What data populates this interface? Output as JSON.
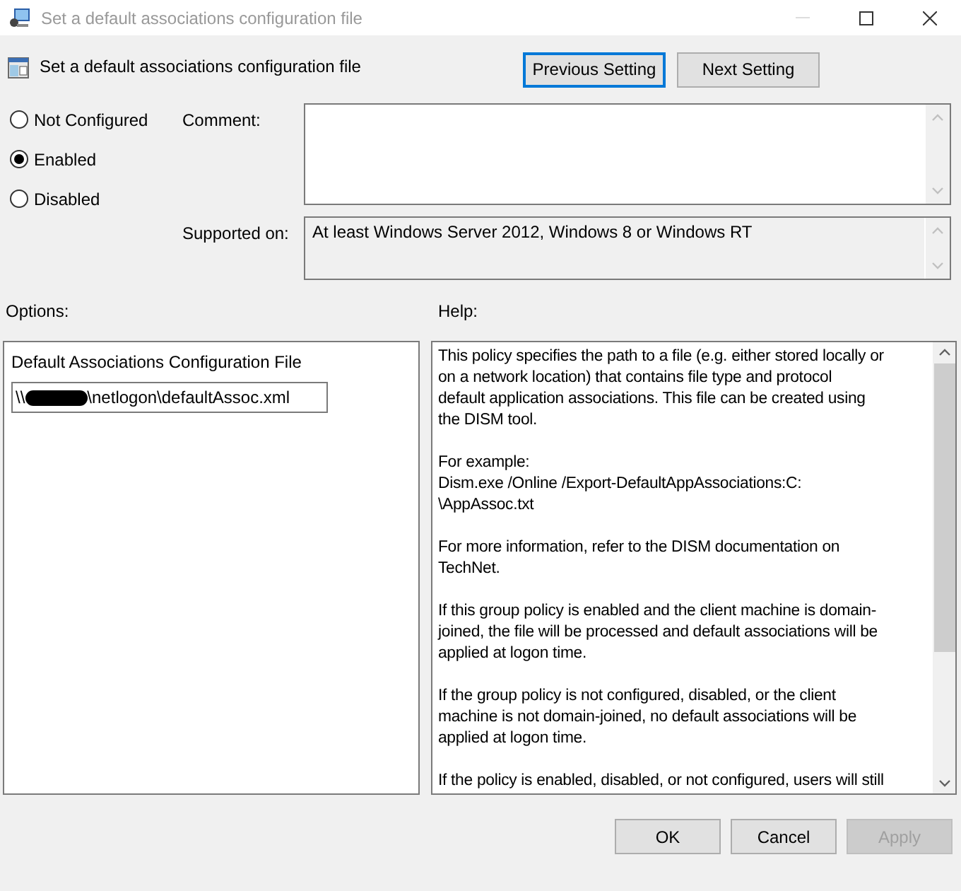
{
  "window": {
    "title": "Set a default associations configuration file"
  },
  "header": {
    "title": "Set a default associations configuration file",
    "buttons": [
      {
        "label": "Previous Setting",
        "focused": true
      },
      {
        "label": "Next Setting",
        "focused": false
      }
    ]
  },
  "state_options": [
    {
      "label": "Not Configured",
      "selected": false
    },
    {
      "label": "Enabled",
      "selected": true
    },
    {
      "label": "Disabled",
      "selected": false
    }
  ],
  "comment": {
    "label": "Comment:"
  },
  "supported_on": {
    "label": "Supported on:",
    "value": "At least Windows Server 2012, Windows 8 or Windows RT"
  },
  "options": {
    "label": "Options:",
    "setting_label": "Default Associations Configuration File",
    "value_start": "\\\\",
    "value_end": "\\netlogon\\defaultAssoc.xml"
  },
  "help": {
    "label": "Help:",
    "paragraphs": [
      [
        "This policy specifies the path to a file (e.g. either stored locally or",
        "on a network location) that contains file type and protocol",
        "default application associations. This file can be created using",
        "the DISM tool."
      ],
      [
        "For example:",
        "Dism.exe /Online /Export-DefaultAppAssociations:C:",
        "\\AppAssoc.txt"
      ],
      [
        "For more information, refer to the DISM documentation on",
        "TechNet."
      ],
      [
        "If this group policy is enabled and the client machine is domain-",
        "joined, the file will be processed and default associations will be",
        "applied at logon time."
      ],
      [
        "If the group policy is not configured, disabled, or the client",
        "machine is not domain-joined, no default associations will be",
        "applied at logon time."
      ],
      [
        "If the policy is enabled, disabled, or not configured, users will still"
      ]
    ]
  },
  "buttons": [
    {
      "label": "OK",
      "disabled": false
    },
    {
      "label": "Cancel",
      "disabled": false
    },
    {
      "label": "Apply",
      "disabled": true
    }
  ]
}
